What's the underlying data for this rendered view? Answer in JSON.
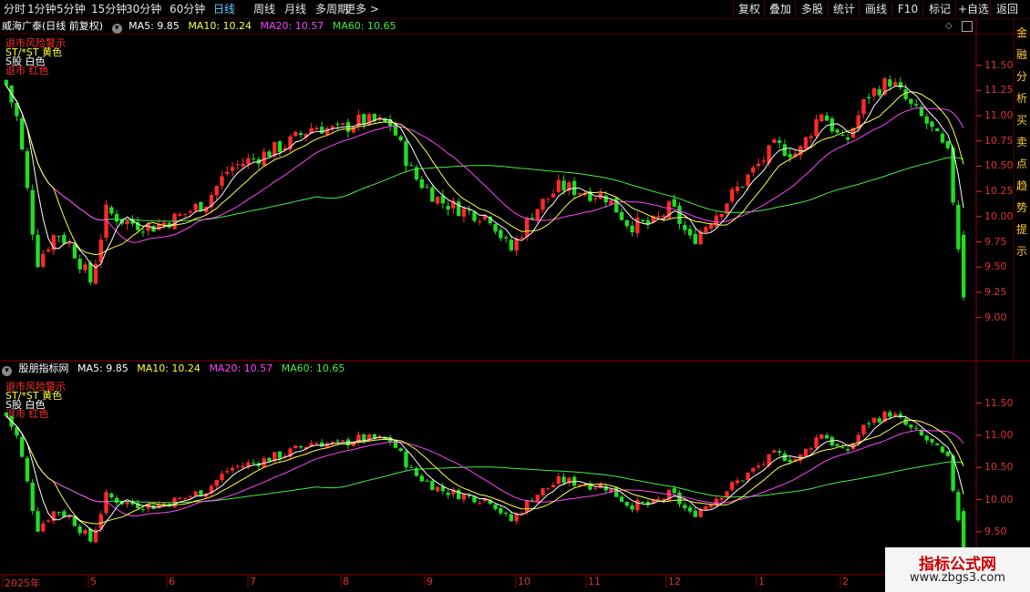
{
  "toolbar": {
    "left": [
      "分时",
      "1分钟",
      "5分钟",
      "15分钟",
      "30分钟",
      "60分钟",
      "日线",
      "周线",
      "月线",
      "多周期",
      "更多 >"
    ],
    "active": "日线",
    "right": [
      "复权",
      "叠加",
      "多股",
      "统计",
      "画线",
      "F10",
      "标记",
      "+自选",
      "返回"
    ]
  },
  "top_panel": {
    "title": "威海广泰(日线 前复权)",
    "ma5": "MA5: 9.85",
    "ma10": "MA10: 10.24",
    "ma20": "MA20: 10.57",
    "ma60": "MA60: 10.65",
    "legend": [
      "退市风险警示",
      "ST/*ST 黄色",
      "S股 白色",
      "退市 红色"
    ],
    "y_ticks": [
      "11.50",
      "11.25",
      "11.00",
      "10.75",
      "10.50",
      "10.25",
      "10.00",
      "9.75",
      "9.50",
      "9.25",
      "9.00"
    ],
    "side_chars": "金融分析买卖点趋势提示"
  },
  "bottom_panel": {
    "title": "股朋指标网",
    "ma5": "MA5: 9.85",
    "ma10": "MA10: 10.24",
    "ma20": "MA20: 10.57",
    "ma60": "MA60: 10.65",
    "legend": [
      "退市风险警示",
      "ST/*ST 黄色",
      "S股 白色",
      "退市 红色"
    ],
    "y_ticks": [
      "11.50",
      "11.00",
      "10.50",
      "10.00",
      "9.50"
    ]
  },
  "x_axis": [
    "2025年",
    "5",
    "6",
    "7",
    "8",
    "9",
    "10",
    "11",
    "12",
    "1",
    "2"
  ],
  "colors": {
    "up": "#ff2a2a",
    "down": "#22dd22",
    "ma5": "#ffffff",
    "ma10": "#ffff44",
    "ma20": "#ff44ff",
    "ma60": "#44ee44",
    "grid": "#5a0000",
    "title": "#ff3333"
  },
  "watermark": {
    "title": "指标公式网",
    "url": "www.zbgs3.com"
  }
}
